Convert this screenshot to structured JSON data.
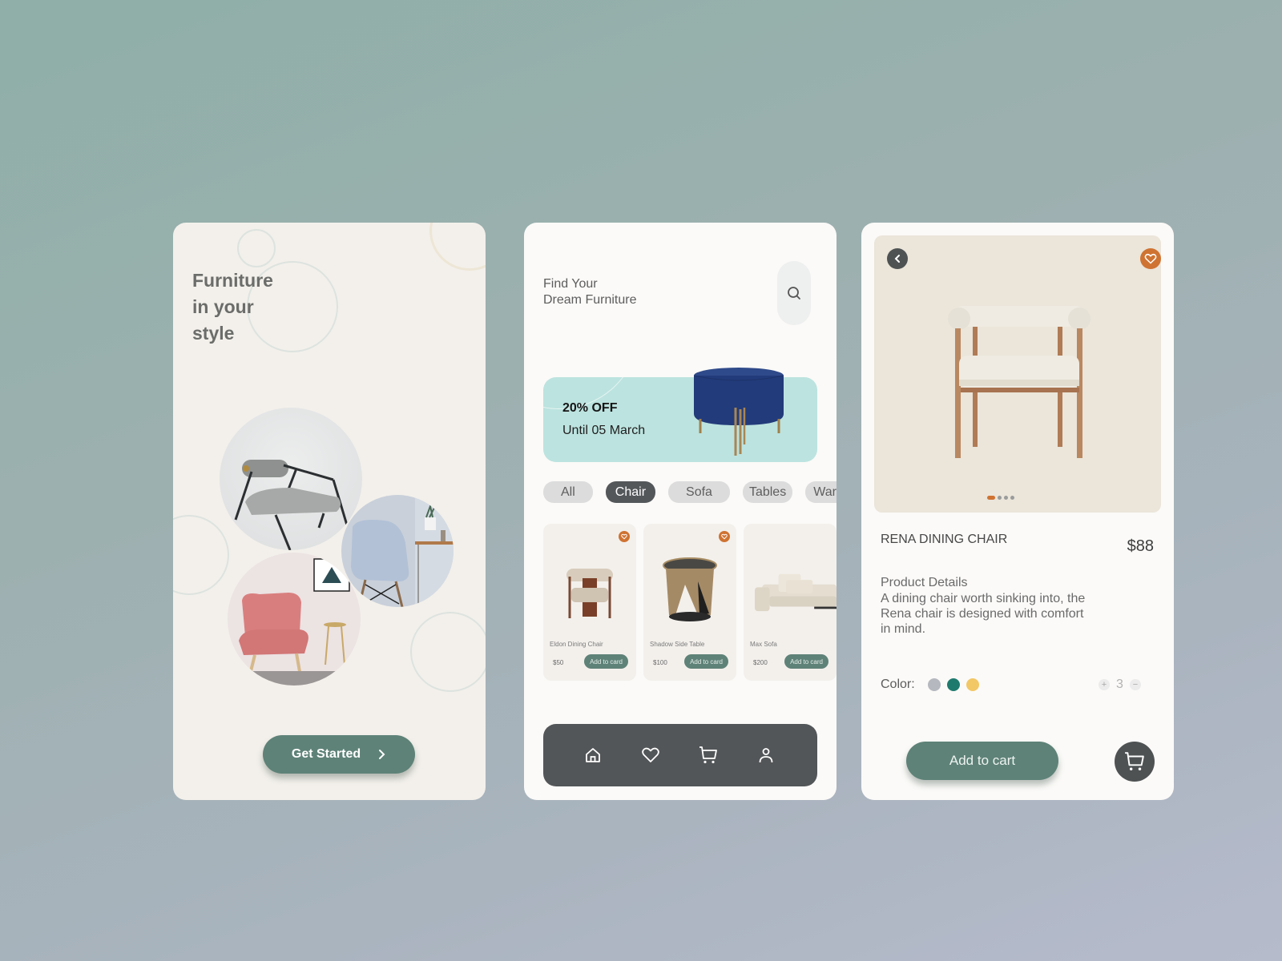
{
  "onboarding": {
    "title": "Furniture\nin your\nstyle",
    "cta_label": "Get Started",
    "photos": [
      "gray-lounge-chair",
      "blue-shell-chair",
      "pink-accent-chair"
    ]
  },
  "browse": {
    "title": "Find Your\nDream Furniture",
    "search_icon": "search-icon",
    "promo": {
      "headline": "20% OFF",
      "subtext": "Until 05 March"
    },
    "categories": [
      {
        "label": "All",
        "active": false
      },
      {
        "label": "Chair",
        "active": true
      },
      {
        "label": "Sofa",
        "active": false
      },
      {
        "label": "Tables",
        "active": false
      },
      {
        "label": "Ward",
        "active": false
      }
    ],
    "products": [
      {
        "name": "Eldon Dining Chair",
        "price": "$50",
        "button": "Add to card",
        "favorited": true
      },
      {
        "name": "Shadow Side Table",
        "price": "$100",
        "button": "Add to card",
        "favorited": true
      },
      {
        "name": "Max Sofa",
        "price": "$200",
        "button": "Add to card",
        "favorited": false
      }
    ],
    "nav": [
      "home-icon",
      "heart-icon",
      "cart-icon",
      "user-icon"
    ]
  },
  "detail": {
    "name": "RENA DINING CHAIR",
    "price": "$88",
    "details_title": "Product Details",
    "details_text": "A dining chair worth sinking into, the Rena chair is designed with comfort in mind.",
    "color_label": "Color:",
    "colors": [
      "#b5b8bf",
      "#1f7a6e",
      "#f2c766"
    ],
    "quantity": "3",
    "qty_plus": "+",
    "qty_minus": "−",
    "carousel": {
      "current": 1,
      "total": 4
    },
    "add_to_cart_label": "Add to cart"
  },
  "theme": {
    "primary": "#5e8278",
    "accent": "#cf7332",
    "dark": "#535658"
  }
}
